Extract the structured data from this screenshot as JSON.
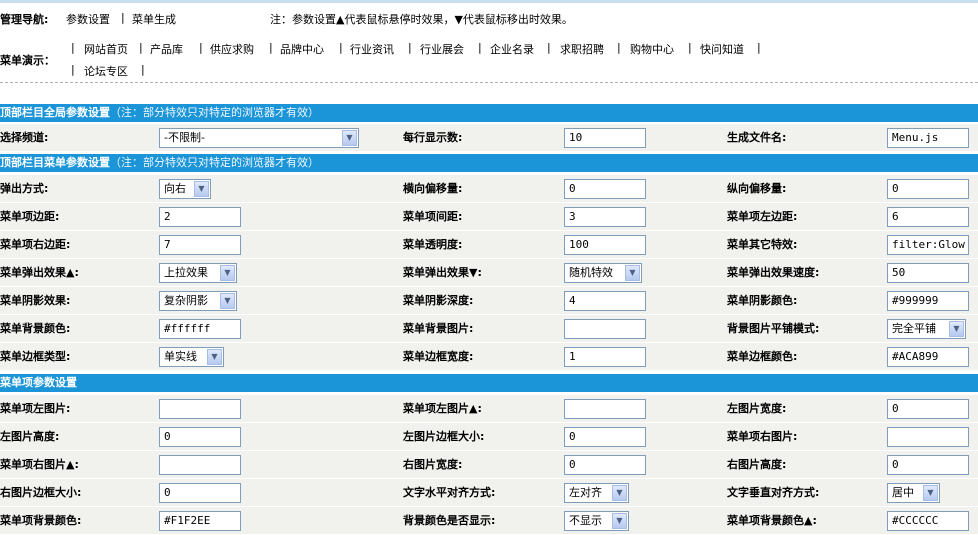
{
  "nav": {
    "title": "管理导航:",
    "link1": "参数设置",
    "sep": "|",
    "link2": "菜单生成",
    "note": "注：参数设置▲代表鼠标悬停时效果，▼代表鼠标移出时效果。"
  },
  "menu_demo": {
    "label": "菜单演示：",
    "items": [
      "网站首页",
      "产品库",
      "供应求购",
      "品牌中心",
      "行业资讯",
      "行业展会",
      "企业名录",
      "求职招聘",
      "购物中心",
      "快问知道",
      "论坛专区"
    ]
  },
  "sections": {
    "global": {
      "title": "顶部栏目全局参数设置",
      "note": "（注：部分特效只对特定的浏览器才有效）"
    },
    "menu": {
      "title": "顶部栏目菜单参数设置",
      "note": "（注：部分特效只对特定的浏览器才有效）"
    },
    "item": {
      "title": "菜单项参数设置"
    }
  },
  "global_row": {
    "channel_label": "选择频道:",
    "channel_value": "-不限制-",
    "perrow_label": "每行显示数:",
    "perrow_value": "10",
    "file_label": "生成文件名:",
    "file_value": "Menu.js"
  },
  "menu_rows": [
    [
      {
        "label": "弹出方式:",
        "value": "向右",
        "type": "select"
      },
      {
        "label": "横向偏移量:",
        "value": "0",
        "type": "input"
      },
      {
        "label": "纵向偏移量:",
        "value": "0",
        "type": "input"
      }
    ],
    [
      {
        "label": "菜单项边距:",
        "value": "2",
        "type": "input"
      },
      {
        "label": "菜单项间距:",
        "value": "3",
        "type": "input"
      },
      {
        "label": "菜单项左边距:",
        "value": "6",
        "type": "input"
      }
    ],
    [
      {
        "label": "菜单项右边距:",
        "value": "7",
        "type": "input"
      },
      {
        "label": "菜单透明度:",
        "value": "100",
        "type": "input"
      },
      {
        "label": "菜单其它特效:",
        "value": "filter:Glow",
        "type": "input"
      }
    ],
    [
      {
        "label": "菜单弹出效果▲:",
        "value": "上拉效果",
        "type": "select"
      },
      {
        "label": "菜单弹出效果▼:",
        "value": "随机特效",
        "type": "select"
      },
      {
        "label": "菜单弹出效果速度:",
        "value": "50",
        "type": "input"
      }
    ],
    [
      {
        "label": "菜单阴影效果:",
        "value": "复杂阴影",
        "type": "select"
      },
      {
        "label": "菜单阴影深度:",
        "value": "4",
        "type": "input"
      },
      {
        "label": "菜单阴影颜色:",
        "value": "#999999",
        "type": "input"
      }
    ],
    [
      {
        "label": "菜单背景颜色:",
        "value": "#ffffff",
        "type": "input"
      },
      {
        "label": "菜单背景图片:",
        "value": "",
        "type": "input"
      },
      {
        "label": "背景图片平铺模式:",
        "value": "完全平铺",
        "type": "select"
      }
    ],
    [
      {
        "label": "菜单边框类型:",
        "value": "单实线",
        "type": "select"
      },
      {
        "label": "菜单边框宽度:",
        "value": "1",
        "type": "input"
      },
      {
        "label": "菜单边框颜色:",
        "value": "#ACA899",
        "type": "input"
      }
    ]
  ],
  "item_rows": [
    [
      {
        "label": "菜单项左图片:",
        "value": "",
        "type": "input"
      },
      {
        "label": "菜单项左图片▲:",
        "value": "",
        "type": "input"
      },
      {
        "label": "左图片宽度:",
        "value": "0",
        "type": "input"
      }
    ],
    [
      {
        "label": "左图片高度:",
        "value": "0",
        "type": "input"
      },
      {
        "label": "左图片边框大小:",
        "value": "0",
        "type": "input"
      },
      {
        "label": "菜单项右图片:",
        "value": "",
        "type": "input"
      }
    ],
    [
      {
        "label": "菜单项右图片▲:",
        "value": "",
        "type": "input"
      },
      {
        "label": "右图片宽度:",
        "value": "0",
        "type": "input"
      },
      {
        "label": "右图片高度:",
        "value": "0",
        "type": "input"
      }
    ],
    [
      {
        "label": "右图片边框大小:",
        "value": "0",
        "type": "input"
      },
      {
        "label": "文字水平对齐方式:",
        "value": "左对齐",
        "type": "select"
      },
      {
        "label": "文字垂直对齐方式:",
        "value": "居中",
        "type": "select"
      }
    ],
    [
      {
        "label": "菜单项背景颜色:",
        "value": "#F1F2EE",
        "type": "input"
      },
      {
        "label": "背景颜色是否显示:",
        "value": "不显示",
        "type": "select"
      },
      {
        "label": "菜单项背景颜色▲:",
        "value": "#CCCCCC",
        "type": "input"
      }
    ]
  ]
}
